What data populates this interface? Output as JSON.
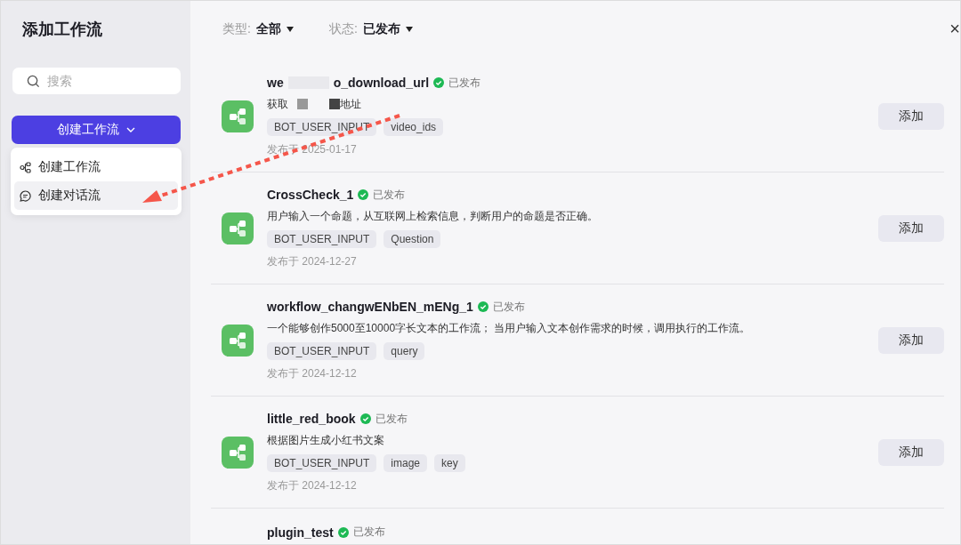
{
  "sidebar": {
    "title": "添加工作流",
    "search": {
      "placeholder": "搜索"
    },
    "create_button": {
      "label": "创建工作流"
    },
    "menu": [
      {
        "kind": "workflow",
        "label": "创建工作流",
        "selected": false
      },
      {
        "kind": "chatflow",
        "label": "创建对话流",
        "selected": true
      }
    ]
  },
  "filters": [
    {
      "label": "类型:",
      "value": "全部"
    },
    {
      "label": "状态:",
      "value": "已发布"
    }
  ],
  "close": "×",
  "workflows": [
    {
      "title_parts": [
        "we",
        "o_download_url"
      ],
      "status": "已发布",
      "description_parts": [
        "获取",
        "地址"
      ],
      "tags": [
        "BOT_USER_INPUT",
        "video_ids"
      ],
      "date": "发布于 2025-01-17",
      "action": "添加"
    },
    {
      "title_parts": [
        "CrossCheck_1"
      ],
      "status": "已发布",
      "description_parts": [
        "用户输入一个命题，从互联网上检索信息，判断用户的命题是否正确。"
      ],
      "tags": [
        "BOT_USER_INPUT",
        "Question"
      ],
      "date": "发布于 2024-12-27",
      "action": "添加"
    },
    {
      "title_parts": [
        "workflow_changwENbEN_mENg_1"
      ],
      "status": "已发布",
      "description_parts": [
        "一个能够创作5000至10000字长文本的工作流； 当用户输入文本创作需求的时候，调用执行的工作流。"
      ],
      "tags": [
        "BOT_USER_INPUT",
        "query"
      ],
      "date": "发布于 2024-12-12",
      "action": "添加"
    },
    {
      "title_parts": [
        "little_red_book"
      ],
      "status": "已发布",
      "description_parts": [
        "根据图片生成小红书文案"
      ],
      "tags": [
        "BOT_USER_INPUT",
        "image",
        "key"
      ],
      "date": "发布于 2024-12-12",
      "action": "添加"
    },
    {
      "title_parts": [
        "plugin_test"
      ],
      "status": "已发布"
    }
  ]
}
